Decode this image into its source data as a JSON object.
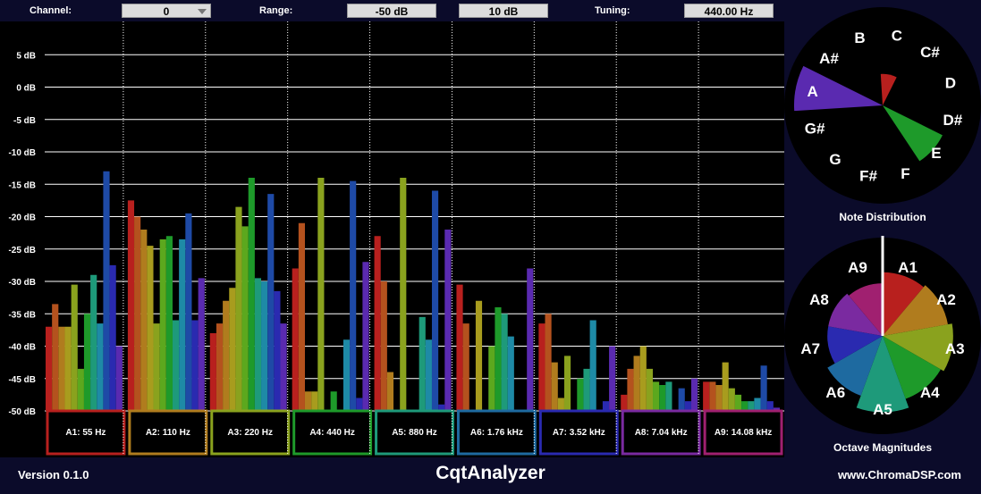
{
  "controls": {
    "channel_label": "Channel:",
    "channel_value": "0",
    "range_label": "Range:",
    "range_min": "-50 dB",
    "range_max": "10 dB",
    "tuning_label": "Tuning:",
    "tuning_value": "440.00 Hz"
  },
  "spectrum": {
    "db_ticks": [
      "5 dB",
      "0 dB",
      "-5 dB",
      "-10 dB",
      "-15 dB",
      "-20 dB",
      "-25 dB",
      "-30 dB",
      "-35 dB",
      "-40 dB",
      "-45 dB",
      "-50 dB"
    ],
    "db_values": [
      5,
      0,
      -5,
      -10,
      -15,
      -20,
      -25,
      -30,
      -35,
      -40,
      -45,
      -50
    ],
    "ylim": [
      -50,
      10
    ],
    "octaves": [
      {
        "label": "A1: 55 Hz",
        "color": "#b8201e"
      },
      {
        "label": "A2: 110 Hz",
        "color": "#b07c1e"
      },
      {
        "label": "A3: 220 Hz",
        "color": "#8aa21e"
      },
      {
        "label": "A4: 440 Hz",
        "color": "#1e9a2a"
      },
      {
        "label": "A5: 880 Hz",
        "color": "#1e9a7a"
      },
      {
        "label": "A6: 1.76 kHz",
        "color": "#1e6aa0"
      },
      {
        "label": "A7: 3.52 kHz",
        "color": "#2a2ab0"
      },
      {
        "label": "A8: 7.04 kHz",
        "color": "#7a2aa0"
      },
      {
        "label": "A9: 14.08 kHz",
        "color": "#a02070"
      }
    ],
    "bin_colors": [
      "#b8201e",
      "#b4521e",
      "#b07c1e",
      "#a89c1e",
      "#8aa21e",
      "#5ca81e",
      "#1e9a2a",
      "#1e9a7a",
      "#1e8aa6",
      "#1e4aa6",
      "#2a2ab0",
      "#5a2ab0",
      "#7a2aa0",
      "#a02070"
    ],
    "bins": [
      [
        -37,
        -33.5,
        -37,
        -37,
        -30.5,
        -43.5,
        -35,
        -29,
        -36.5,
        -13,
        -27.5,
        -40
      ],
      [
        -17.5,
        -20,
        -22,
        -24.5,
        -36.5,
        -23.5,
        -23,
        -36,
        -23.5,
        -19.5,
        -36,
        -29.5
      ],
      [
        -38,
        -36.5,
        -33,
        -31,
        -18.5,
        -21.5,
        -14,
        -29.5,
        -30,
        -16.5,
        -31.5,
        -36.5
      ],
      [
        -28,
        -21,
        -47,
        -47,
        -14,
        -50,
        -47,
        -50,
        -39,
        -14.5,
        -48,
        -27
      ],
      [
        -23,
        -30,
        -44,
        -50,
        -14,
        -50,
        -50,
        -35.5,
        -39,
        -16,
        -49,
        -22
      ],
      [
        -30.5,
        -36.5,
        -50,
        -33,
        -50,
        -40,
        -34,
        -35,
        -38.5,
        -50,
        -50,
        -28
      ],
      [
        -36.5,
        -35,
        -42.5,
        -48,
        -41.5,
        -50,
        -45,
        -43.5,
        -36,
        -50,
        -48.5,
        -40
      ],
      [
        -47.5,
        -43.5,
        -41.5,
        -40,
        -43.5,
        -45.5,
        -46,
        -45.5,
        -50,
        -46.5,
        -48.5,
        -45
      ],
      [
        -45.5,
        -45.5,
        -46,
        -42.5,
        -46.5,
        -47.5,
        -48.5,
        -48.5,
        -48,
        -43,
        -48.5,
        -49.5
      ]
    ]
  },
  "note_distribution": {
    "title": "Note Distribution",
    "notes": [
      "C",
      "C#",
      "D",
      "D#",
      "E",
      "F",
      "F#",
      "G",
      "G#",
      "A",
      "A#",
      "B"
    ],
    "magnitudes": [
      0.32,
      0,
      0,
      0,
      0.68,
      0,
      0,
      0,
      0,
      0.9,
      0,
      0
    ],
    "colors": [
      "#b8201e",
      "#c02020",
      "#b4521e",
      "#1e9a2a",
      "#1e9a2a",
      "#1e9a7a",
      "#1e8aa6",
      "#1e4aa6",
      "#2a2ab0",
      "#5a2ab0",
      "#7a2aa0",
      "#a02070"
    ]
  },
  "octave_magnitudes": {
    "title": "Octave Magnitudes",
    "labels": [
      "A1",
      "A2",
      "A3",
      "A4",
      "A5",
      "A6",
      "A7",
      "A8",
      "A9"
    ],
    "magnitudes": [
      0.75,
      0.78,
      0.83,
      0.79,
      0.9,
      0.75,
      0.65,
      0.65,
      0.62
    ],
    "colors": [
      "#b8201e",
      "#b07c1e",
      "#8aa21e",
      "#1e9a2a",
      "#1e9a7a",
      "#1e6aa0",
      "#2a2ab0",
      "#7a2aa0",
      "#a02070"
    ]
  },
  "footer": {
    "version": "Version 0.1.0",
    "app_title": "CqtAnalyzer",
    "website": "www.ChromaDSP.com"
  }
}
